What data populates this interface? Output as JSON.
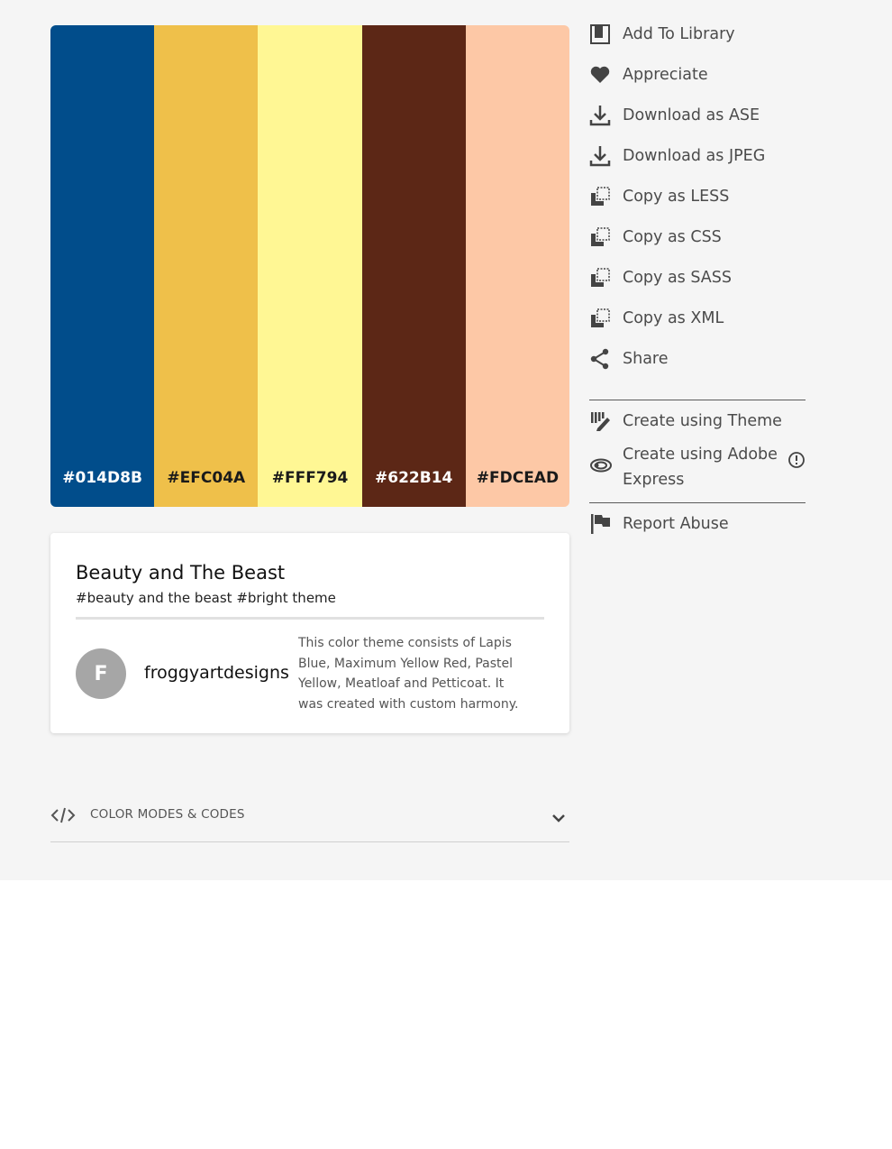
{
  "palette": {
    "swatches": [
      {
        "hex": "#014D8B",
        "color": "#014D8B",
        "text_color": "#ffffff"
      },
      {
        "hex": "#EFC04A",
        "color": "#EFC04A",
        "text_color": "#1a1a1a"
      },
      {
        "hex": "#FFF794",
        "color": "#FFF794",
        "text_color": "#1a1a1a"
      },
      {
        "hex": "#622B14",
        "color": "#5C2716",
        "text_color": "#ffffff"
      },
      {
        "hex": "#FDCEAD",
        "color": "#FDC8A6",
        "text_color": "#1a1a1a"
      }
    ]
  },
  "theme": {
    "title": "Beauty and The Beast",
    "tags": "#beauty and the beast #bright theme",
    "author_initial": "F",
    "author": "froggyartdesigns",
    "description": "This color theme consists of Lapis Blue, Maximum Yellow Red, Pastel Yellow, Meatloaf and Petticoat. It was created with custom harmony."
  },
  "color_modes": {
    "label": "COLOR MODES & CODES"
  },
  "actions": {
    "add_to_library": "Add To Library",
    "appreciate": "Appreciate",
    "download_ase": "Download as ASE",
    "download_jpeg": "Download as JPEG",
    "copy_less": "Copy as LESS",
    "copy_css": "Copy as CSS",
    "copy_sass": "Copy as SASS",
    "copy_xml": "Copy as XML",
    "share": "Share",
    "create_theme": "Create using Theme",
    "create_express": "Create using Adobe Express",
    "report_abuse": "Report Abuse"
  },
  "icons": {
    "add_to_library": "library-icon",
    "appreciate": "heart-icon",
    "download": "download-icon",
    "copy": "copy-icon",
    "share": "share-icon",
    "create_theme": "palette-pen-icon",
    "create_express": "creative-cloud-icon",
    "info": "info-icon",
    "report": "flag-icon",
    "code": "code-icon",
    "chevron": "chevron-down-icon"
  }
}
